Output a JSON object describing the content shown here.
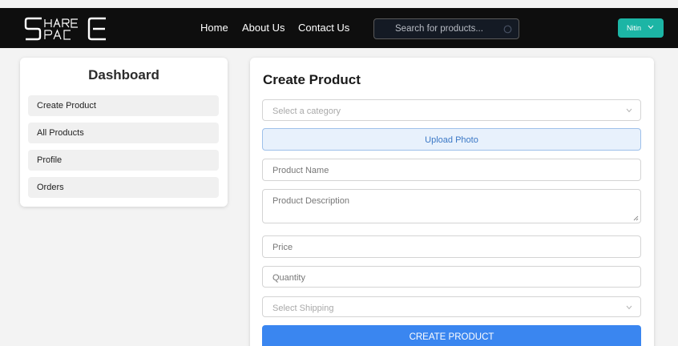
{
  "brand": {
    "logo_text": "SHARE SPACE"
  },
  "nav": {
    "home": "Home",
    "about": "About Us",
    "contact": "Contact Us",
    "search_placeholder": "Search for products...",
    "user_name": "Nitin"
  },
  "sidebar": {
    "title": "Dashboard",
    "items": [
      {
        "label": "Create Product"
      },
      {
        "label": "All Products"
      },
      {
        "label": "Profile"
      },
      {
        "label": "Orders"
      }
    ]
  },
  "form": {
    "title": "Create Product",
    "category_placeholder": "Select a category",
    "upload_label": "Upload Photo",
    "name_placeholder": "Product Name",
    "description_placeholder": "Product Description",
    "price_placeholder": "Price",
    "quantity_placeholder": "Quantity",
    "shipping_placeholder": "Select Shipping",
    "submit_label": "CREATE PRODUCT"
  },
  "colors": {
    "navbar": "#0e0e0e",
    "user_button": "#1cb5a5",
    "primary": "#3a86f0",
    "upload_bg": "#e8f1fc"
  },
  "icons": {
    "search": "search-icon",
    "dropdown": "chevron-down-icon"
  }
}
